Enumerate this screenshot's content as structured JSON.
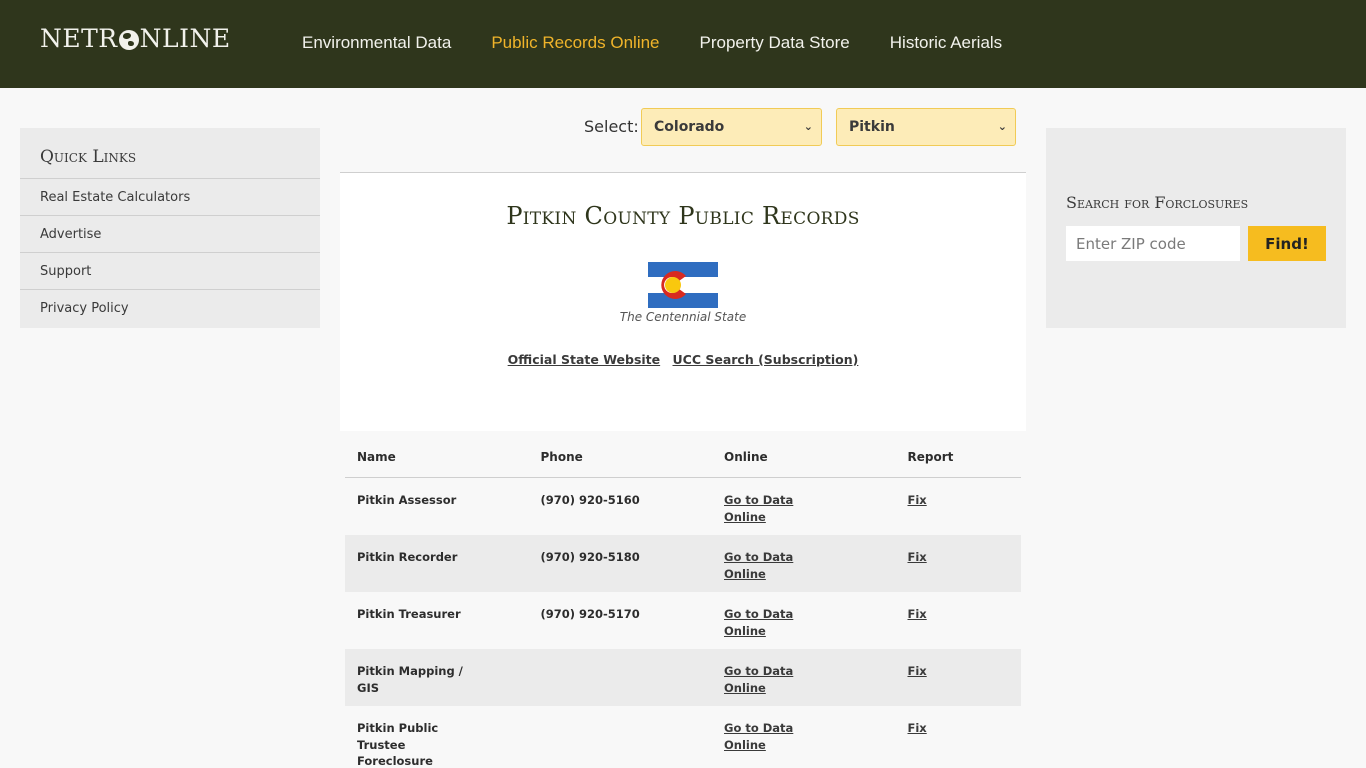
{
  "header": {
    "logo_left": "NETR",
    "logo_right": "NLINE",
    "nav": [
      {
        "label": "Environmental Data",
        "active": false
      },
      {
        "label": "Public Records Online",
        "active": true
      },
      {
        "label": "Property Data Store",
        "active": false
      },
      {
        "label": "Historic Aerials",
        "active": false
      }
    ]
  },
  "colors": {
    "header_bg": "#2f361c",
    "accent": "#f0b42a",
    "button": "#f6bc1f",
    "select_bg": "#fdecb8"
  },
  "selector": {
    "label": "Select:",
    "state": "Colorado",
    "county": "Pitkin"
  },
  "quick_links": {
    "title": "Quick Links",
    "items": [
      "Real Estate Calculators",
      "Advertise",
      "Support",
      "Privacy Policy"
    ]
  },
  "foreclosure_search": {
    "title": "Search for Forclosures",
    "placeholder": "Enter ZIP code",
    "button": "Find!"
  },
  "main": {
    "title": "Pitkin County Public Records",
    "flag_icon": "colorado-flag-icon",
    "motto": "The Centennial State",
    "links": [
      "Official State Website",
      "UCC Search (Subscription)"
    ]
  },
  "table": {
    "headers": [
      "Name",
      "Phone",
      "Online",
      "Report"
    ],
    "rows": [
      {
        "name": "Pitkin Assessor",
        "phone": "(970) 920-5160",
        "online": "Go to Data Online",
        "report": "Fix"
      },
      {
        "name": "Pitkin Recorder",
        "phone": "(970) 920-5180",
        "online": "Go to Data Online",
        "report": "Fix"
      },
      {
        "name": "Pitkin Treasurer",
        "phone": "(970) 920-5170",
        "online": "Go to Data Online",
        "report": "Fix"
      },
      {
        "name": "Pitkin Mapping / GIS",
        "phone": "",
        "online": "Go to Data Online",
        "report": "Fix"
      },
      {
        "name": "Pitkin Public Trustee Foreclosure",
        "phone": "",
        "online": "Go to Data Online",
        "report": "Fix"
      }
    ]
  }
}
